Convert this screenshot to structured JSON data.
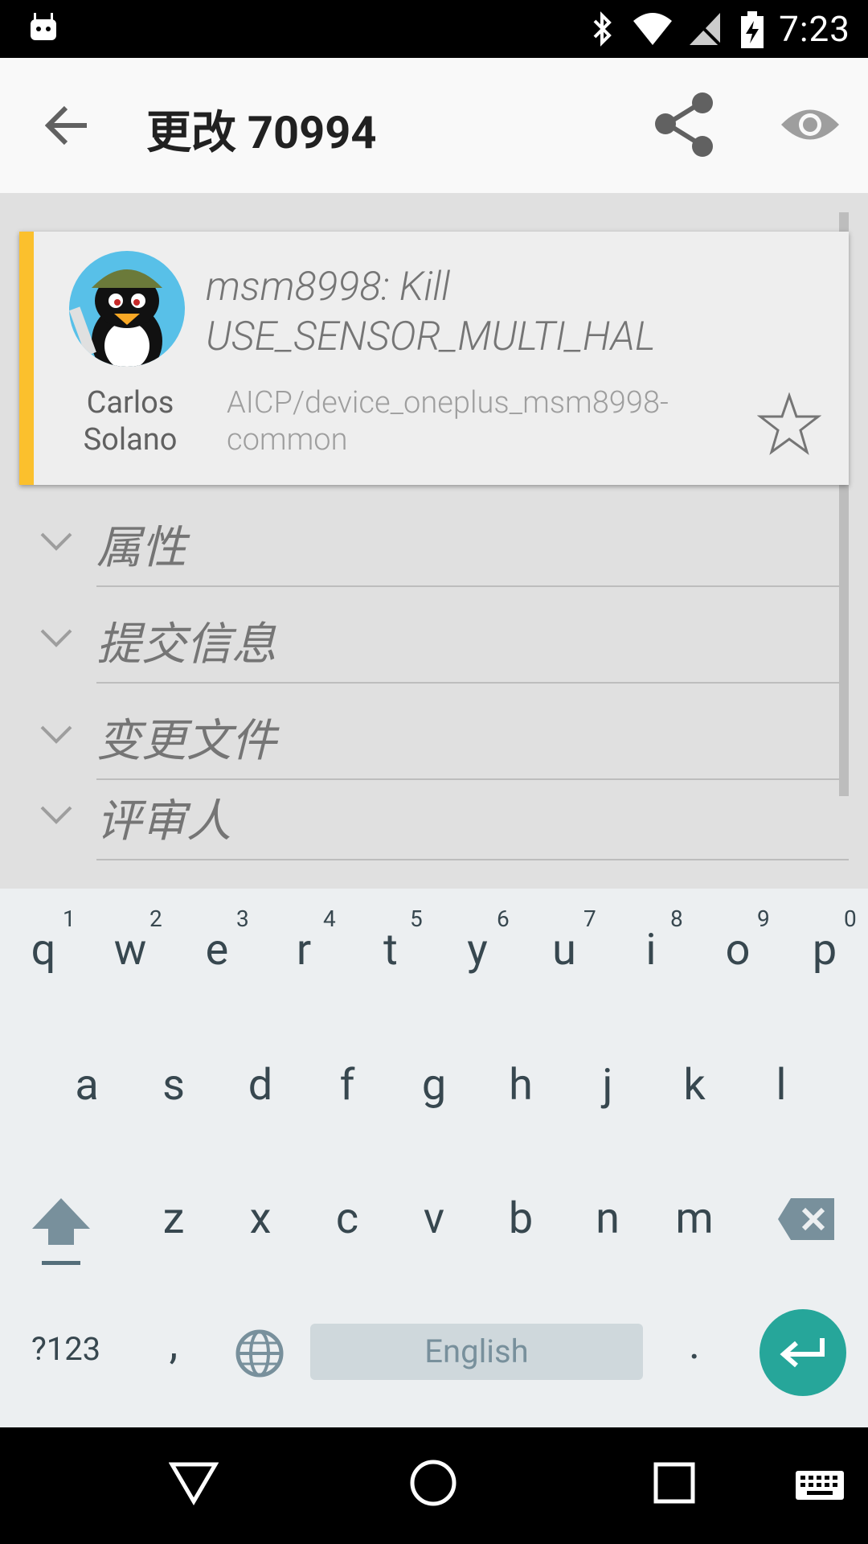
{
  "status_bar": {
    "time": "7:23"
  },
  "app_bar": {
    "title": "更改 70994"
  },
  "change": {
    "subject": "msm8998: Kill USE_SENSOR_MULTI_HAL",
    "author": "Carlos Solano",
    "project": "AICP/device_oneplus_msm8998-common",
    "accent_color": "#fbc02d"
  },
  "sections": [
    {
      "label": "属性"
    },
    {
      "label": "提交信息"
    },
    {
      "label": "变更文件"
    },
    {
      "label": "评审人"
    }
  ],
  "keyboard": {
    "row1": [
      "q",
      "w",
      "e",
      "r",
      "t",
      "y",
      "u",
      "i",
      "o",
      "p"
    ],
    "row1_hints": [
      "1",
      "2",
      "3",
      "4",
      "5",
      "6",
      "7",
      "8",
      "9",
      "0"
    ],
    "row2": [
      "a",
      "s",
      "d",
      "f",
      "g",
      "h",
      "j",
      "k",
      "l"
    ],
    "row3": [
      "z",
      "x",
      "c",
      "v",
      "b",
      "n",
      "m"
    ],
    "symbols_label": "?123",
    "comma": ",",
    "period": ".",
    "space_label": "English"
  },
  "colors": {
    "enter": "#26a69a",
    "accent": "#fbc02d"
  }
}
